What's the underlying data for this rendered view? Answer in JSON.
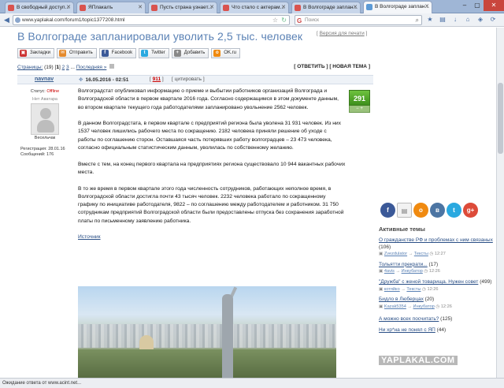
{
  "browser": {
    "tabs": [
      {
        "title": "В свободный доступ..."
      },
      {
        "title": "ЯПлакалъ"
      },
      {
        "title": "Пусть страна узнает..."
      },
      {
        "title": "Что стало с актерам..."
      },
      {
        "title": "В Волгограде заплан..."
      },
      {
        "title": "В Волгограде заплан..."
      }
    ],
    "url": "www.yaplakal.com/forum1/topic1377208.html",
    "search_placeholder": "Поиск",
    "status": "Ожидание ответа от www.acint.net..."
  },
  "page": {
    "title": "В Волгограде запланировали уволить 2,5 тыс. человек",
    "print_link": "Версия для печати",
    "share_buttons": [
      {
        "label": "Закладки"
      },
      {
        "label": "Отправить"
      },
      {
        "label": "Facebook"
      },
      {
        "label": "Twitter"
      },
      {
        "label": "Добавить"
      },
      {
        "label": "OK.ru"
      }
    ],
    "pager": {
      "label": "Страницы:",
      "total": "(19)",
      "current": "1",
      "pages": [
        "2",
        "3"
      ],
      "ellipsis": "...",
      "last": "Последняя »",
      "reply": "ОТВЕТИТЬ",
      "new_topic": "НОВАЯ ТЕМА"
    },
    "post": {
      "author": "navnav",
      "date": "16.05.2016 - 02:51",
      "number": "911",
      "quote": "цитировать",
      "status_label": "Статус:",
      "status_value": "Offline",
      "no_avatar": "Нет Аватара",
      "rank": "Весельчак",
      "registered": "Регистрация: 28.01.16",
      "messages": "Сообщений: 176",
      "rating": "291",
      "paragraphs": [
        "Волгоградстат опубликовал информацию о приеме и выбытии работников организаций Волгограда и Волгоградской области в первом квартале 2016 года. Согласно содержащимся в этом документе данным, во втором квартале текущего года работодателями запланировано увольнение 2562 человек.",
        "В данном Волгоградстата, в первом квартале с предприятий региона была уволена 31 931 человек. Из них 1537 человек лишились рабочего места по сокращению. 2182 человека приняли решение об уходе с работы по соглашению сторон. Оставшаяся часть потерявших работу волгоградцев – 23 473 человека, согласно официальным статистическим данным, уволилась по собственному желанию.",
        "Вместе с тем, на конец первого квартала на предприятиях региона существовало 10 944 вакантных рабочих места.",
        "В то же время в первом квартале этого года численность сотрудников, работающих неполное время, в Волгоградской области достигла почти 43 тысяч человек. 2232 человека работало по сокращенному графику по инициативе работодателя, 9822 – по соглашению между работодателем и работником. 31 750 сотрудникам предприятий Волгоградской области были предоставлены отпуска без сохранения заработной платы по письменному заявлению работника."
      ],
      "source_link": "Источник"
    }
  },
  "sidebar": {
    "social_icons": [
      "facebook-icon",
      "document-icon",
      "odnoklassniki-icon",
      "vk-icon",
      "twitter-icon",
      "google-plus-icon"
    ],
    "title": "Активные темы",
    "topics": [
      {
        "title": "О гражданстве РФ и проблемах с ним связаных",
        "count": "(106)",
        "user": "Zvezdulator",
        "cat": "Тексты",
        "time": "12:27"
      },
      {
        "title": "Тольятти прекрати...",
        "count": "(17)",
        "user": "4avis",
        "cat": "Инкубатор",
        "time": "12:26"
      },
      {
        "title": "\"Дружба\" с женой товарища. Нужен совет",
        "count": "(499)",
        "user": "котяйко",
        "cat": "Тексты",
        "time": "12:26"
      },
      {
        "title": "Бидло в Люберцах",
        "count": "(20)",
        "user": "Kazak5354",
        "cat": "Инкубатор",
        "time": "12:26"
      },
      {
        "title": "А можно всех посчитать?",
        "count": "(125)"
      },
      {
        "title": "Ни хр*на не понял с ЯП",
        "count": "(44)"
      }
    ],
    "watermark": "YAPLAKAL.COM"
  }
}
